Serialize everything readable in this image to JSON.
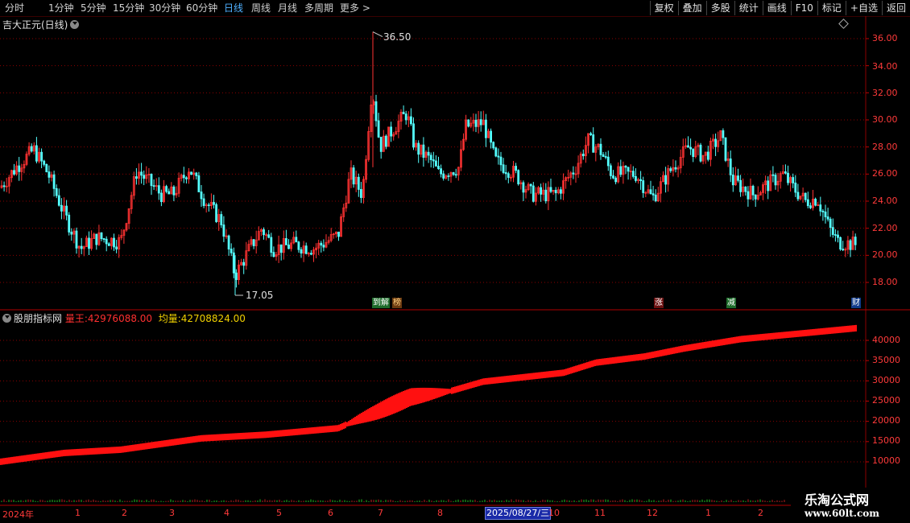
{
  "toolbar": {
    "periods": [
      "分时",
      "1分钟",
      "5分钟",
      "15分钟",
      "30分钟",
      "60分钟",
      "日线",
      "周线",
      "月线",
      "多周期",
      "更多 >"
    ],
    "active_period": "日线",
    "tools": [
      "复权",
      "叠加",
      "多股",
      "统计",
      "画线",
      "F10",
      "标记",
      "+自选",
      "返回"
    ]
  },
  "main_chart": {
    "title": "吉大正元(日线)",
    "high_label": "36.50",
    "low_label": "17.05",
    "price_axis": [
      "36.00",
      "34.00",
      "32.00",
      "30.00",
      "28.00",
      "26.00",
      "24.00",
      "22.00",
      "20.00",
      "18.00"
    ],
    "markers": [
      "到解",
      "榜",
      "涨",
      "减",
      "财"
    ]
  },
  "indicator": {
    "name": "股朋指标网",
    "series1_label": "量王:",
    "series1_value": "42976088.00",
    "series2_label": "均量:",
    "series2_value": "42708824.00",
    "axis": [
      "40000",
      "35000",
      "30000",
      "25000",
      "20000",
      "15000",
      "10000"
    ]
  },
  "x_axis": {
    "labels": [
      "2024年",
      "1",
      "2",
      "3",
      "4",
      "5",
      "6",
      "7",
      "8",
      "10",
      "11",
      "12",
      "1",
      "2"
    ],
    "selected_date": "2025/08/27/三"
  },
  "watermark": {
    "line1": "乐淘公式网",
    "line2": "www.60lt.com"
  },
  "colors": {
    "up": "#ff3232",
    "down": "#54ffff",
    "grid": "#8b0000",
    "accent": "#4fb0ff"
  },
  "chart_data": {
    "type": "candlestick",
    "price_range": [
      16.5,
      37.2
    ],
    "high": 36.5,
    "low": 17.05,
    "indicator_range": [
      0,
      45000
    ],
    "indicator_end": 42976,
    "indicator_avg_end": 42709
  }
}
